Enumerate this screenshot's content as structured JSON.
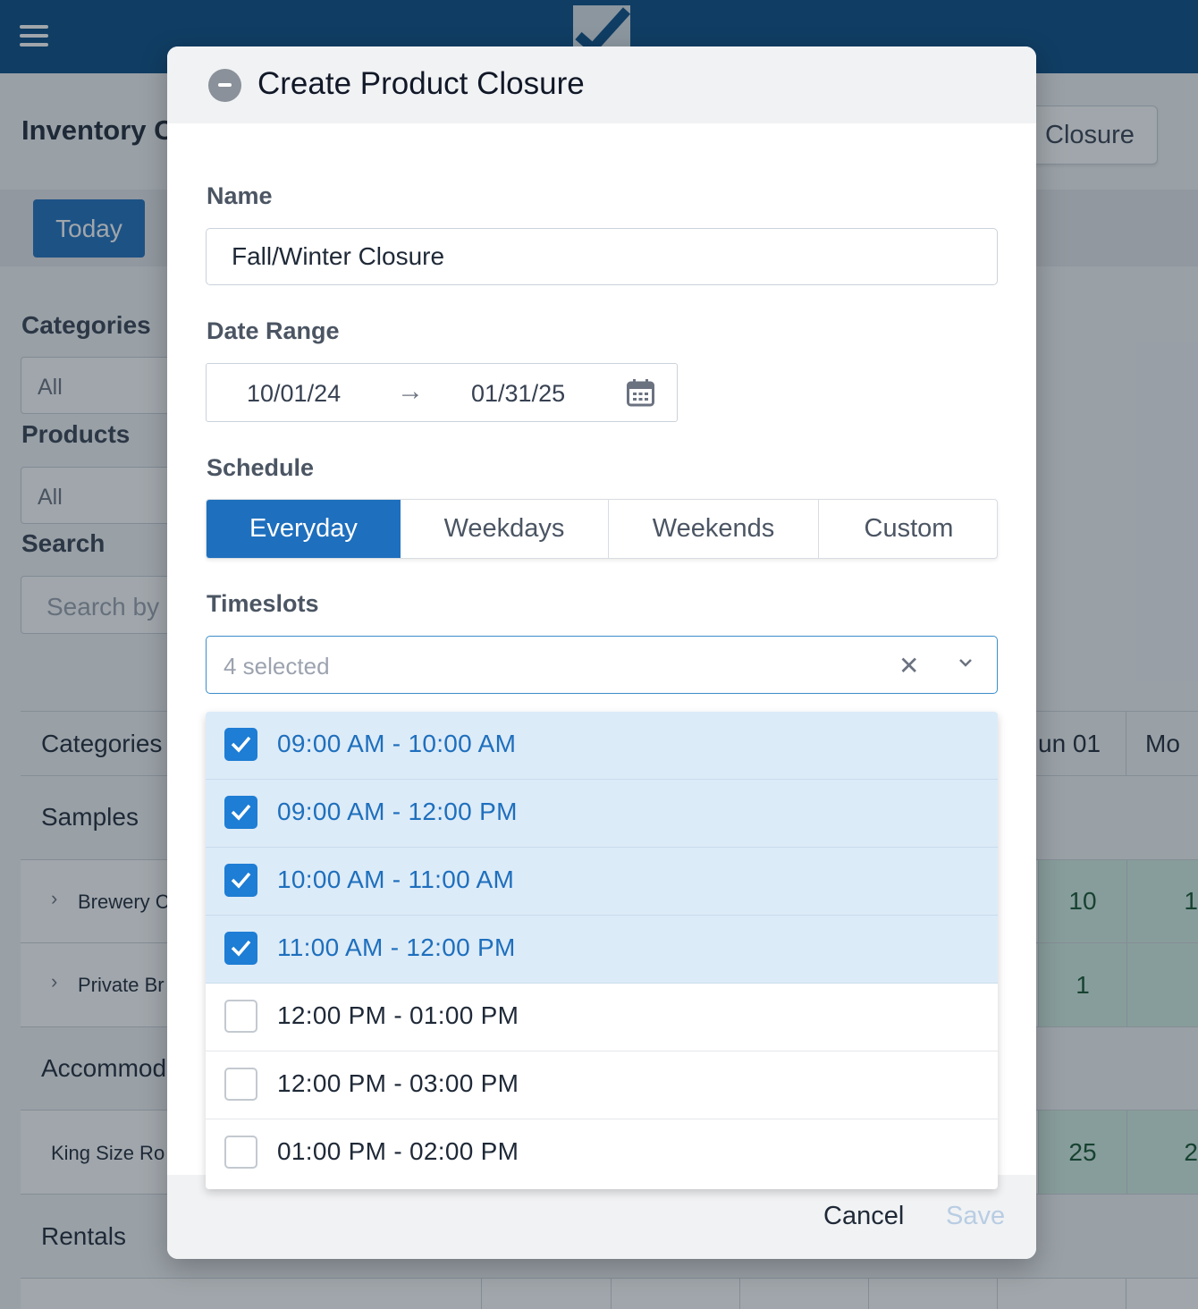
{
  "app": {
    "page_title": "Inventory C",
    "add_closure_label": "Closure",
    "today_label": "Today"
  },
  "sidebar": {
    "categories_label": "Categories",
    "categories_value": "All",
    "products_label": "Products",
    "products_value": "All",
    "search_label": "Search",
    "search_placeholder": "Search by"
  },
  "grid": {
    "header_first": "Categories",
    "header_cols": [
      "un 01",
      "Mo"
    ],
    "rows": [
      {
        "type": "cat",
        "label": "Samples"
      },
      {
        "type": "prod",
        "label": "Brewery C",
        "values": [
          "10",
          "1"
        ]
      },
      {
        "type": "prod",
        "label": "Private Br",
        "values": [
          "1",
          ""
        ]
      },
      {
        "type": "cat",
        "label": "Accommod"
      },
      {
        "type": "prod",
        "label": "King Size Ro",
        "values": [
          "25",
          "2"
        ]
      },
      {
        "type": "cat",
        "label": "Rentals"
      }
    ]
  },
  "modal": {
    "title": "Create Product Closure",
    "name_label": "Name",
    "name_value": "Fall/Winter Closure",
    "date_range_label": "Date Range",
    "date_start": "10/01/24",
    "date_end": "01/31/25",
    "schedule_label": "Schedule",
    "schedule_options": [
      "Everyday",
      "Weekdays",
      "Weekends",
      "Custom"
    ],
    "schedule_selected": "Everyday",
    "timeslots_label": "Timeslots",
    "timeslots_value": "4 selected",
    "cancel_label": "Cancel",
    "save_label": "Save"
  },
  "timeslot_options": [
    {
      "label": "09:00 AM - 10:00 AM",
      "checked": true
    },
    {
      "label": "09:00 AM - 12:00 PM",
      "checked": true
    },
    {
      "label": "10:00 AM - 11:00 AM",
      "checked": true
    },
    {
      "label": "11:00 AM - 12:00 PM",
      "checked": true
    },
    {
      "label": "12:00 PM - 01:00 PM",
      "checked": false
    },
    {
      "label": "12:00 PM - 03:00 PM",
      "checked": false
    },
    {
      "label": "01:00 PM - 02:00 PM",
      "checked": false
    }
  ],
  "icons": {
    "menu": "hamburger-icon",
    "logo": "checkmark-logo-icon",
    "collapse": "minus-circle-icon",
    "arrow": "arrow-right-icon",
    "calendar": "calendar-icon",
    "clear": "close-icon",
    "dropdown": "chevron-down-icon",
    "expand": "chevron-right-icon"
  },
  "colors": {
    "brand_header": "#084b83",
    "primary": "#1e6fbd",
    "selected_row": "#dcebf8",
    "checkbox_checked": "#1e7dd4",
    "availability_cell": "#d4f0e4"
  }
}
